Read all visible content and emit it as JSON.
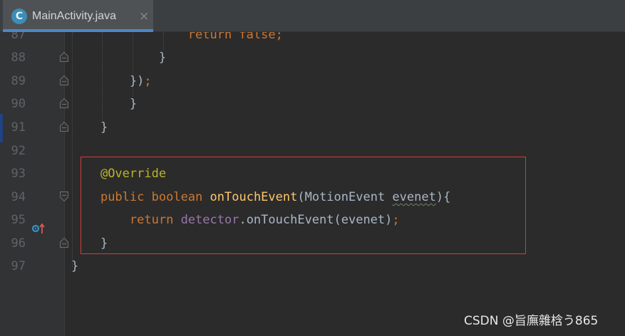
{
  "tab": {
    "icon_letter": "C",
    "title": "MainActivity.java",
    "close": "×"
  },
  "line_numbers": [
    "87",
    "88",
    "89",
    "90",
    "91",
    "92",
    "93",
    "94",
    "95",
    "96",
    "97"
  ],
  "code": {
    "l87": {
      "return": "return",
      "false": "false",
      "semi": ";"
    },
    "l88": {
      "text": "}"
    },
    "l89": {
      "brace": "})",
      "semi": ";"
    },
    "l90": {
      "text": "}"
    },
    "l91": {
      "text": "}"
    },
    "l93": {
      "annotation": "@Override"
    },
    "l94": {
      "public": "public",
      "boolean": "boolean",
      "method": "onTouchEvent",
      "open": "(MotionEvent ",
      "param": "evenet",
      "close": "){"
    },
    "l95": {
      "return": "return",
      "field": "detector",
      "call": ".onTouchEvent(evenet)",
      "semi": ";"
    },
    "l96": {
      "text": "}"
    },
    "l97": {
      "text": "}"
    }
  },
  "watermark": "CSDN @旨廡雜梒う865",
  "colors": {
    "keyword": "#cc7832",
    "method": "#ffc66d",
    "annotation": "#bbb529",
    "field": "#9876aa",
    "text": "#a9b7c6",
    "highlight_box": "#d63b35"
  }
}
